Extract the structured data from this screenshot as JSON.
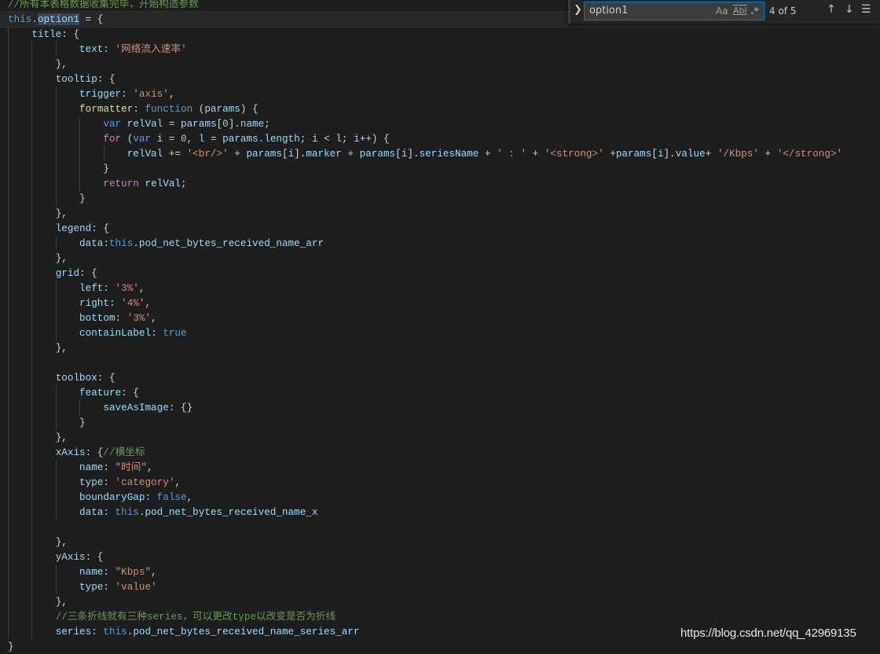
{
  "editor": {
    "current_line": 1,
    "lines": [
      {
        "i": 0,
        "t": [
          [
            "c",
            "//所有本表格数据收集完毕，开始构造参数"
          ]
        ]
      },
      {
        "i": 0,
        "t": [
          [
            "k",
            "this"
          ],
          [
            "t",
            "."
          ],
          [
            "sel",
            "option1"
          ],
          [
            "t",
            " = {"
          ]
        ]
      },
      {
        "i": 4,
        "t": [
          [
            "p",
            "title"
          ],
          [
            "t",
            ": {"
          ]
        ]
      },
      {
        "i": 12,
        "t": [
          [
            "p",
            "text"
          ],
          [
            "t",
            ": "
          ],
          [
            "s",
            "'网络流入速率'"
          ]
        ]
      },
      {
        "i": 8,
        "t": [
          [
            "t",
            "},"
          ]
        ]
      },
      {
        "i": 8,
        "t": [
          [
            "p",
            "tooltip"
          ],
          [
            "t",
            ": {"
          ]
        ]
      },
      {
        "i": 12,
        "t": [
          [
            "p",
            "trigger"
          ],
          [
            "t",
            ": "
          ],
          [
            "s",
            "'axis'"
          ],
          [
            "t",
            ","
          ]
        ]
      },
      {
        "i": 12,
        "t": [
          [
            "f",
            "formatter"
          ],
          [
            "t",
            ": "
          ],
          [
            "k",
            "function"
          ],
          [
            "t",
            " ("
          ],
          [
            "p",
            "params"
          ],
          [
            "t",
            ") {"
          ]
        ]
      },
      {
        "i": 16,
        "t": [
          [
            "k",
            "var"
          ],
          [
            "t",
            " "
          ],
          [
            "p",
            "relVal"
          ],
          [
            "t",
            " = "
          ],
          [
            "p",
            "params"
          ],
          [
            "t",
            "["
          ],
          [
            "n",
            "0"
          ],
          [
            "t",
            "]."
          ],
          [
            "p",
            "name"
          ],
          [
            "t",
            ";"
          ]
        ]
      },
      {
        "i": 16,
        "t": [
          [
            "ctl",
            "for"
          ],
          [
            "t",
            " ("
          ],
          [
            "k",
            "var"
          ],
          [
            "t",
            " "
          ],
          [
            "p",
            "i"
          ],
          [
            "t",
            " = "
          ],
          [
            "n",
            "0"
          ],
          [
            "t",
            ", "
          ],
          [
            "p",
            "l"
          ],
          [
            "t",
            " = "
          ],
          [
            "p",
            "params"
          ],
          [
            "t",
            "."
          ],
          [
            "p",
            "length"
          ],
          [
            "t",
            "; "
          ],
          [
            "p",
            "i"
          ],
          [
            "t",
            " < "
          ],
          [
            "p",
            "l"
          ],
          [
            "t",
            "; "
          ],
          [
            "p",
            "i"
          ],
          [
            "t",
            "++) {"
          ]
        ]
      },
      {
        "i": 20,
        "t": [
          [
            "p",
            "relVal"
          ],
          [
            "t",
            " += "
          ],
          [
            "s",
            "'<br/>'"
          ],
          [
            "t",
            " + "
          ],
          [
            "p",
            "params"
          ],
          [
            "t",
            "["
          ],
          [
            "p",
            "i"
          ],
          [
            "t",
            "]."
          ],
          [
            "p",
            "marker"
          ],
          [
            "t",
            " + "
          ],
          [
            "p",
            "params"
          ],
          [
            "t",
            "["
          ],
          [
            "p",
            "i"
          ],
          [
            "t",
            "]."
          ],
          [
            "p",
            "seriesName"
          ],
          [
            "t",
            " + "
          ],
          [
            "s",
            "' : '"
          ],
          [
            "t",
            " + "
          ],
          [
            "s",
            "'<strong>'"
          ],
          [
            "t",
            " +"
          ],
          [
            "p",
            "params"
          ],
          [
            "t",
            "["
          ],
          [
            "p",
            "i"
          ],
          [
            "t",
            "]."
          ],
          [
            "p",
            "value"
          ],
          [
            "t",
            "+ "
          ],
          [
            "s",
            "'/Kbps'"
          ],
          [
            "t",
            " + "
          ],
          [
            "s",
            "'</strong>'"
          ]
        ]
      },
      {
        "i": 16,
        "t": [
          [
            "t",
            "}"
          ]
        ]
      },
      {
        "i": 16,
        "t": [
          [
            "ctl",
            "return"
          ],
          [
            "t",
            " "
          ],
          [
            "p",
            "relVal"
          ],
          [
            "t",
            ";"
          ]
        ]
      },
      {
        "i": 12,
        "t": [
          [
            "t",
            "}"
          ]
        ]
      },
      {
        "i": 8,
        "t": [
          [
            "t",
            "},"
          ]
        ]
      },
      {
        "i": 8,
        "t": [
          [
            "p",
            "legend"
          ],
          [
            "t",
            ": {"
          ]
        ]
      },
      {
        "i": 12,
        "t": [
          [
            "p",
            "data"
          ],
          [
            "t",
            ":"
          ],
          [
            "k",
            "this"
          ],
          [
            "t",
            "."
          ],
          [
            "p",
            "pod_net_bytes_received_name_arr"
          ]
        ]
      },
      {
        "i": 8,
        "t": [
          [
            "t",
            "},"
          ]
        ]
      },
      {
        "i": 8,
        "t": [
          [
            "p",
            "grid"
          ],
          [
            "t",
            ": {"
          ]
        ]
      },
      {
        "i": 12,
        "t": [
          [
            "p",
            "left"
          ],
          [
            "t",
            ": "
          ],
          [
            "s",
            "'3%'"
          ],
          [
            "t",
            ","
          ]
        ]
      },
      {
        "i": 12,
        "t": [
          [
            "p",
            "right"
          ],
          [
            "t",
            ": "
          ],
          [
            "s",
            "'4%'"
          ],
          [
            "t",
            ","
          ]
        ]
      },
      {
        "i": 12,
        "t": [
          [
            "p",
            "bottom"
          ],
          [
            "t",
            ": "
          ],
          [
            "s",
            "'3%'"
          ],
          [
            "t",
            ","
          ]
        ]
      },
      {
        "i": 12,
        "t": [
          [
            "p",
            "containLabel"
          ],
          [
            "t",
            ": "
          ],
          [
            "k",
            "true"
          ]
        ]
      },
      {
        "i": 8,
        "t": [
          [
            "t",
            "},"
          ]
        ]
      },
      {
        "i": 0,
        "t": []
      },
      {
        "i": 8,
        "t": [
          [
            "p",
            "toolbox"
          ],
          [
            "t",
            ": {"
          ]
        ]
      },
      {
        "i": 12,
        "t": [
          [
            "p",
            "feature"
          ],
          [
            "t",
            ": {"
          ]
        ]
      },
      {
        "i": 16,
        "t": [
          [
            "p",
            "saveAsImage"
          ],
          [
            "t",
            ": {}"
          ]
        ]
      },
      {
        "i": 12,
        "t": [
          [
            "t",
            "}"
          ]
        ]
      },
      {
        "i": 8,
        "t": [
          [
            "t",
            "},"
          ]
        ]
      },
      {
        "i": 8,
        "t": [
          [
            "p",
            "xAxis"
          ],
          [
            "t",
            ": {"
          ],
          [
            "c",
            "//横坐标"
          ]
        ]
      },
      {
        "i": 12,
        "t": [
          [
            "p",
            "name"
          ],
          [
            "t",
            ": "
          ],
          [
            "s",
            "\"时间\""
          ],
          [
            "t",
            ","
          ]
        ]
      },
      {
        "i": 12,
        "t": [
          [
            "p",
            "type"
          ],
          [
            "t",
            ": "
          ],
          [
            "s",
            "'category'"
          ],
          [
            "t",
            ","
          ]
        ]
      },
      {
        "i": 12,
        "t": [
          [
            "p",
            "boundaryGap"
          ],
          [
            "t",
            ": "
          ],
          [
            "k",
            "false"
          ],
          [
            "t",
            ","
          ]
        ]
      },
      {
        "i": 12,
        "t": [
          [
            "p",
            "data"
          ],
          [
            "t",
            ": "
          ],
          [
            "k",
            "this"
          ],
          [
            "t",
            "."
          ],
          [
            "p",
            "pod_net_bytes_received_name_x"
          ]
        ]
      },
      {
        "i": 0,
        "t": []
      },
      {
        "i": 8,
        "t": [
          [
            "t",
            "},"
          ]
        ]
      },
      {
        "i": 8,
        "t": [
          [
            "p",
            "yAxis"
          ],
          [
            "t",
            ": {"
          ]
        ]
      },
      {
        "i": 12,
        "t": [
          [
            "p",
            "name"
          ],
          [
            "t",
            ": "
          ],
          [
            "s",
            "\"Kbps\""
          ],
          [
            "t",
            ","
          ]
        ]
      },
      {
        "i": 12,
        "t": [
          [
            "p",
            "type"
          ],
          [
            "t",
            ": "
          ],
          [
            "s",
            "'value'"
          ]
        ]
      },
      {
        "i": 8,
        "t": [
          [
            "t",
            "},"
          ]
        ]
      },
      {
        "i": 8,
        "t": [
          [
            "c",
            "//三条折线就有三种series，可以更改type以改变是否为折线"
          ]
        ]
      },
      {
        "i": 8,
        "t": [
          [
            "p",
            "series"
          ],
          [
            "t",
            ": "
          ],
          [
            "k",
            "this"
          ],
          [
            "t",
            "."
          ],
          [
            "p",
            "pod_net_bytes_received_name_series_arr"
          ]
        ]
      },
      {
        "i": 0,
        "t": [
          [
            "t",
            "}"
          ]
        ]
      }
    ]
  },
  "find_widget": {
    "toggle_icon": "chevron-right",
    "query": "option1",
    "match_case": "Aa",
    "whole_word": "Abl",
    "regex": ".*",
    "count": "4 of 5",
    "prev_icon": "arrow-up",
    "next_icon": "arrow-down",
    "selection_icon": "lines"
  },
  "watermark": "https://blog.csdn.net/qq_42969135",
  "colors": {
    "background": "#1e1e1e",
    "keyword": "#569cd6",
    "property": "#9cdcfe",
    "string": "#ce9178",
    "comment": "#6a9955",
    "accent": "#007acc"
  }
}
